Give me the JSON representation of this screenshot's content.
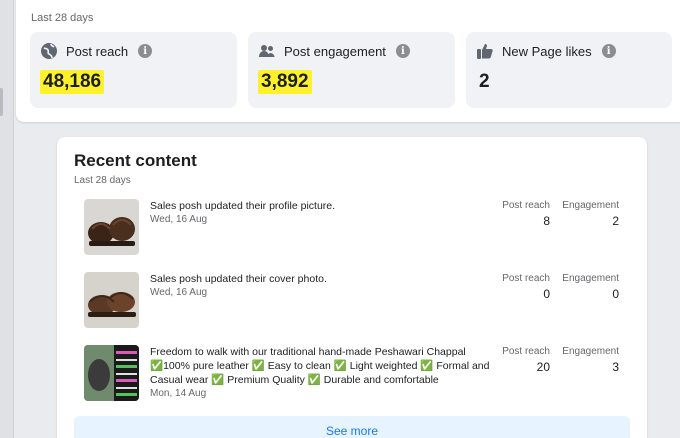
{
  "summary": {
    "period": "Last 28 days",
    "metrics": [
      {
        "label": "Post reach",
        "value": "48,186",
        "icon": "globe-icon",
        "highlighted": true
      },
      {
        "label": "Post engagement",
        "value": "3,892",
        "icon": "people-icon",
        "highlighted": true
      },
      {
        "label": "New Page likes",
        "value": "2",
        "icon": "thumbs-up-icon",
        "highlighted": false
      }
    ]
  },
  "recent": {
    "title": "Recent content",
    "period": "Last 28 days",
    "reach_header": "Post reach",
    "engagement_header": "Engagement",
    "posts": [
      {
        "text": "Sales posh updated their profile picture.",
        "date": "Wed, 16 Aug",
        "reach": "8",
        "engagement": "2"
      },
      {
        "text": "Sales posh updated their cover photo.",
        "date": "Wed, 16 Aug",
        "reach": "0",
        "engagement": "0"
      },
      {
        "text": "Freedom to walk with our traditional hand-made Peshawari Chappal ✅100% pure leather ✅ Easy to clean ✅ Light weighted ✅ Formal and Casual wear ✅ Premium Quality ✅ Durable and comfortable",
        "date": "Mon, 14 Aug",
        "reach": "20",
        "engagement": "3"
      }
    ],
    "see_more": "See more"
  },
  "colors": {
    "accent": "#1877f2",
    "highlight": "#fdf12b",
    "tile_bg": "#f0f2f5"
  }
}
